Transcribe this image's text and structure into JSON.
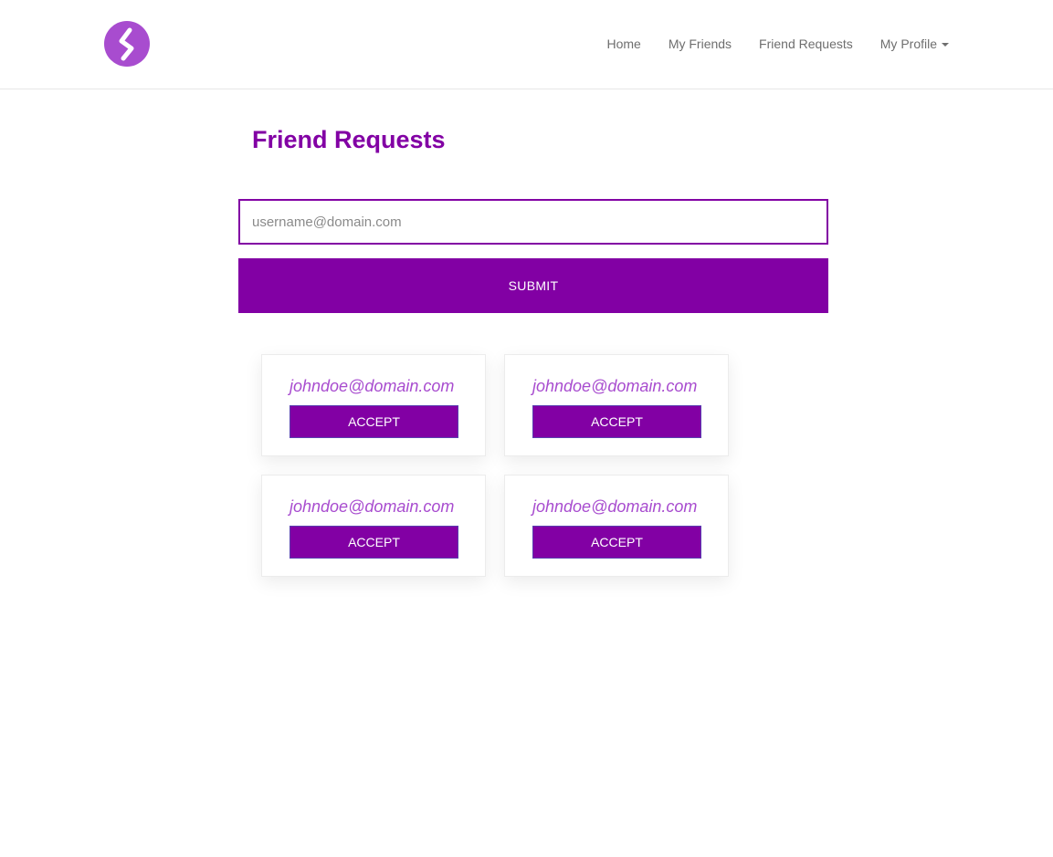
{
  "nav": {
    "logo_icon": "s-logo-icon",
    "brand_color": "#a84ccf",
    "items": [
      {
        "label": "Home"
      },
      {
        "label": "My Friends"
      },
      {
        "label": "Friend Requests"
      },
      {
        "label": "My Profile"
      }
    ]
  },
  "main": {
    "title": "Friend Requests",
    "input_placeholder": "username@domain.com",
    "input_value": "",
    "submit_label": "SUBMIT",
    "accent_color": "#8200a4"
  },
  "requests": [
    {
      "email": "johndoe@domain.com",
      "button_label": "ACCEPT"
    },
    {
      "email": "johndoe@domain.com",
      "button_label": "ACCEPT"
    },
    {
      "email": "johndoe@domain.com",
      "button_label": "ACCEPT"
    },
    {
      "email": "johndoe@domain.com",
      "button_label": "ACCEPT"
    }
  ]
}
